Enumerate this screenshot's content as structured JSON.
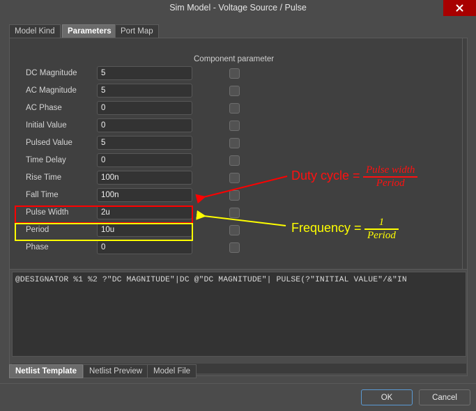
{
  "window": {
    "title": "Sim Model - Voltage Source / Pulse",
    "close_icon": "close-icon",
    "close_color": "#a80000"
  },
  "tabs": {
    "items": [
      {
        "label": "Model Kind",
        "active": false
      },
      {
        "label": "Parameters",
        "active": true
      },
      {
        "label": "Port Map",
        "active": false
      }
    ]
  },
  "parameters_panel": {
    "component_parameter_header": "Component parameter",
    "rows": [
      {
        "label": "DC Magnitude",
        "value": "5",
        "checked": false
      },
      {
        "label": "AC Magnitude",
        "value": "5",
        "checked": false
      },
      {
        "label": "AC Phase",
        "value": "0",
        "checked": false
      },
      {
        "label": "Initial Value",
        "value": "0",
        "checked": false
      },
      {
        "label": "Pulsed Value",
        "value": "5",
        "checked": false
      },
      {
        "label": "Time Delay",
        "value": "0",
        "checked": false
      },
      {
        "label": "Rise Time",
        "value": "100n",
        "checked": false
      },
      {
        "label": "Fall Time",
        "value": "100n",
        "checked": false
      },
      {
        "label": "Pulse Width",
        "value": "2u",
        "checked": false
      },
      {
        "label": "Period",
        "value": "10u",
        "checked": false
      },
      {
        "label": "Phase",
        "value": "0",
        "checked": false
      }
    ]
  },
  "annotations": {
    "duty_cycle": {
      "label": "Duty cycle =",
      "numerator": "Pulse width",
      "denominator": "Period",
      "color": "#ff0000"
    },
    "frequency": {
      "label": "Frequency =",
      "numerator": "1",
      "denominator": "Period",
      "color": "#ffff00"
    }
  },
  "netlist": {
    "template_text": "@DESIGNATOR %1 %2 ?\"DC MAGNITUDE\"|DC @\"DC MAGNITUDE\"| PULSE(?\"INITIAL VALUE\"/&\"IN",
    "scroll_left_icon": "scroll-left-arrow-icon"
  },
  "bottom_tabs": {
    "items": [
      {
        "label": "Netlist Template",
        "active": true
      },
      {
        "label": "Netlist Preview",
        "active": false
      },
      {
        "label": "Model File",
        "active": false
      }
    ]
  },
  "footer": {
    "ok_label": "OK",
    "cancel_label": "Cancel"
  }
}
